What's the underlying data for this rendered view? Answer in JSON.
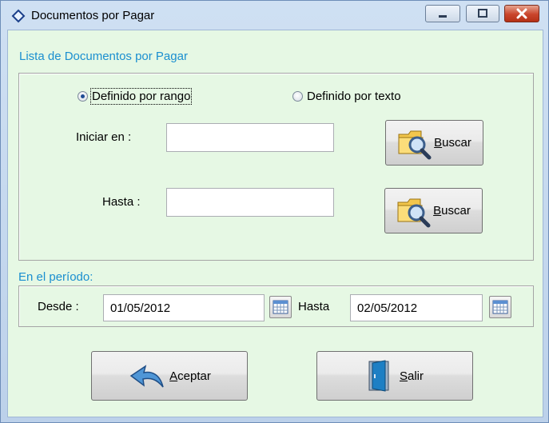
{
  "window": {
    "title": "Documentos por Pagar",
    "icon": "diamond-app-icon",
    "controls": [
      "minimize-icon",
      "maximize-icon",
      "close-icon"
    ]
  },
  "list_section": {
    "heading": "Lista de Documentos por Pagar",
    "radio_range": {
      "label": "Definido por rango",
      "checked": true
    },
    "radio_text": {
      "label": "Definido por texto",
      "checked": false
    },
    "start": {
      "label": "Iniciar en  :",
      "value": ""
    },
    "end": {
      "label": "Hasta  :",
      "value": ""
    },
    "search_button": {
      "accel": "B",
      "rest": "uscar",
      "icon": "folder-magnifier-icon"
    }
  },
  "period_section": {
    "heading": "En el período:",
    "from_label": "Desde :",
    "from_value": "01/05/2012",
    "to_label": "Hasta",
    "to_value": "02/05/2012",
    "calendar_icon": "calendar-icon"
  },
  "actions": {
    "accept": {
      "accel": "A",
      "rest": "ceptar",
      "icon": "curved-arrow-icon"
    },
    "exit": {
      "accel": "S",
      "rest": "alir",
      "icon": "door-exit-icon"
    }
  },
  "colors": {
    "client_bg": "#e6f8e4",
    "accent_label": "#1b8fd0",
    "frame": "#c9d9ec"
  }
}
